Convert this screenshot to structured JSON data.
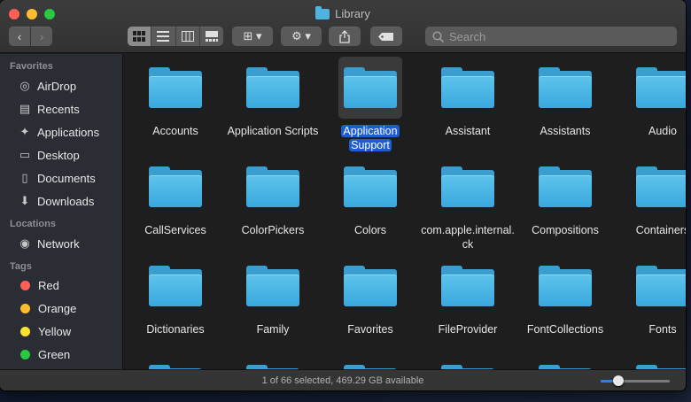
{
  "window": {
    "title": "Library"
  },
  "toolbar": {
    "back": "‹",
    "forward": "›",
    "group_icon": "⊞ ▾",
    "action_icon": "⚙ ▾",
    "share_icon": "⇪",
    "tag_icon": "▭",
    "search_placeholder": "Search"
  },
  "sidebar": {
    "sections": {
      "favorites": "Favorites",
      "locations": "Locations",
      "tags": "Tags"
    },
    "favorites": [
      {
        "label": "AirDrop",
        "icon": "airdrop-icon",
        "glyph": "◎"
      },
      {
        "label": "Recents",
        "icon": "recents-icon",
        "glyph": "▤"
      },
      {
        "label": "Applications",
        "icon": "applications-icon",
        "glyph": "✦"
      },
      {
        "label": "Desktop",
        "icon": "desktop-icon",
        "glyph": "▭"
      },
      {
        "label": "Documents",
        "icon": "documents-icon",
        "glyph": "▯"
      },
      {
        "label": "Downloads",
        "icon": "downloads-icon",
        "glyph": "⬇"
      }
    ],
    "locations": [
      {
        "label": "Network",
        "icon": "network-icon",
        "glyph": "◉"
      }
    ],
    "tags": [
      {
        "label": "Red",
        "color": "#fe5f57"
      },
      {
        "label": "Orange",
        "color": "#febc2e"
      },
      {
        "label": "Yellow",
        "color": "#fde32b"
      },
      {
        "label": "Green",
        "color": "#28c840"
      }
    ]
  },
  "files": {
    "rows": [
      [
        "Accounts",
        "Application Scripts",
        "Application Support",
        "Assistant",
        "Assistants",
        "Audio"
      ],
      [
        "CallServices",
        "ColorPickers",
        "Colors",
        "com.apple.internal.ck",
        "Compositions",
        "Containers"
      ],
      [
        "Dictionaries",
        "Family",
        "Favorites",
        "FileProvider",
        "FontCollections",
        "Fonts"
      ]
    ],
    "selected": "Application Support",
    "colors": {
      "selection": "#1d5cd1",
      "folder": "#3aa8dc"
    }
  },
  "status": {
    "text": "1 of 66 selected, 469.29 GB available",
    "zoom_level": 0.25
  }
}
